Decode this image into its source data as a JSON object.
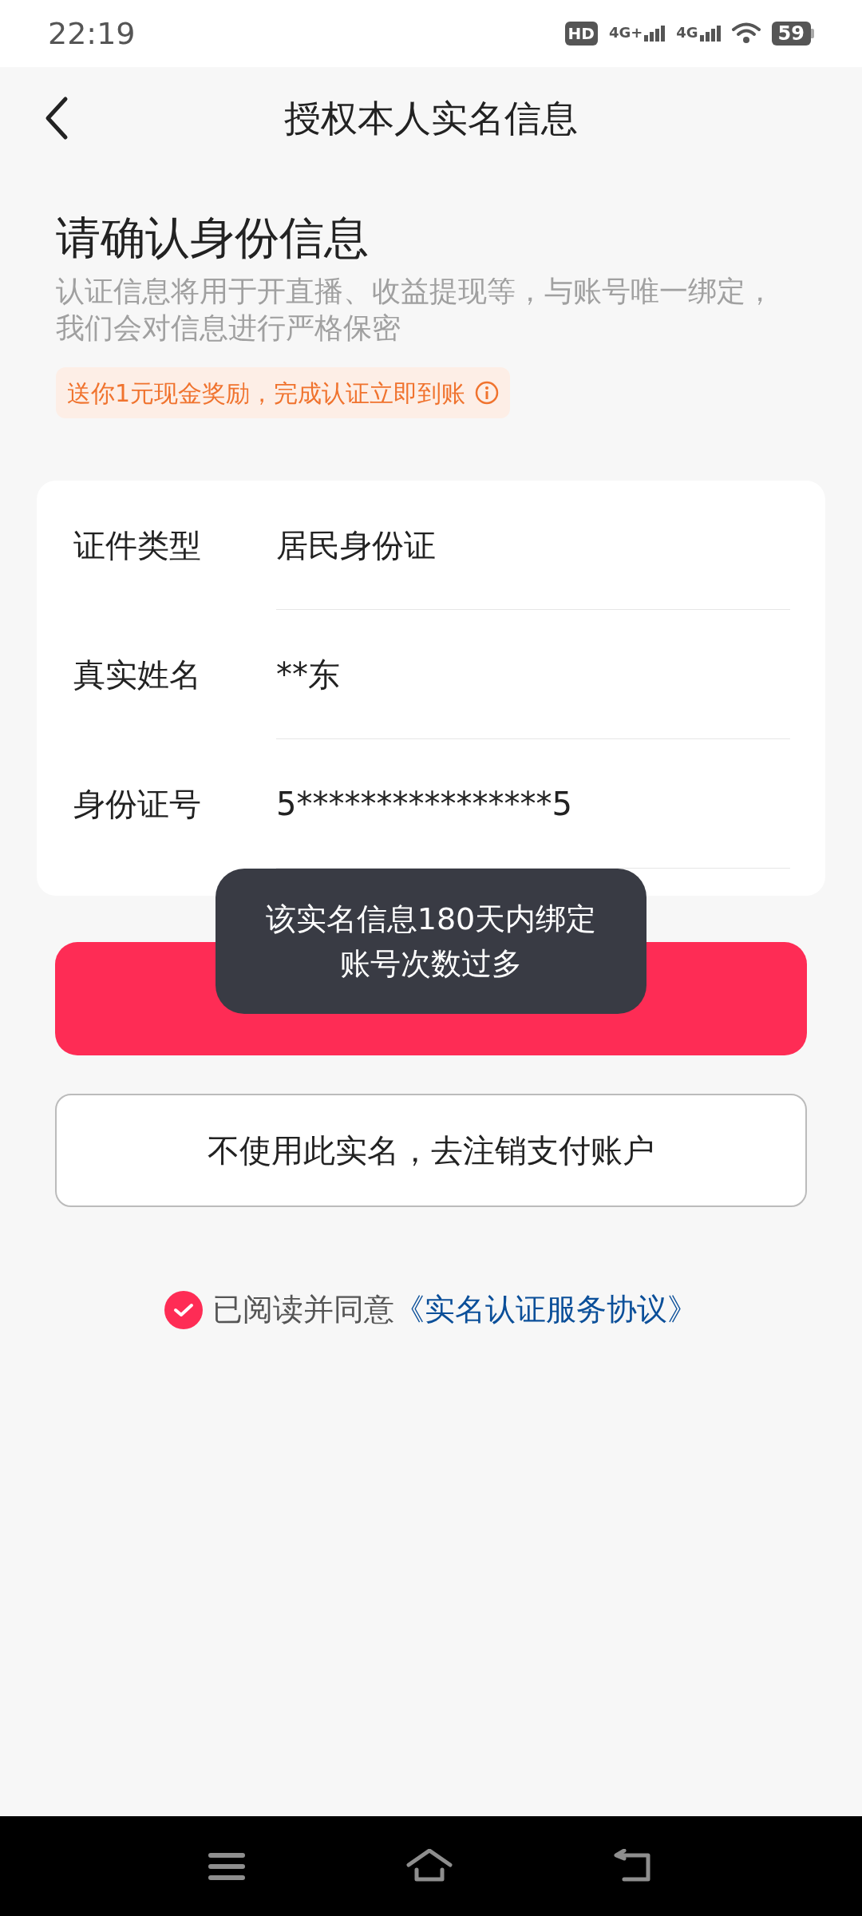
{
  "status_bar": {
    "time": "22:19",
    "hd": "HD",
    "networks": [
      "4G+",
      "4G"
    ],
    "battery": "59"
  },
  "header": {
    "title": "授权本人实名信息"
  },
  "intro": {
    "heading": "请确认身份信息",
    "description": "认证信息将用于开直播、收益提现等，与账号唯一绑定，我们会对信息进行严格保密",
    "reward": "送你1元现金奖励，完成认证立即到账"
  },
  "fields": [
    {
      "label": "证件类型",
      "value": "居民身份证"
    },
    {
      "label": "真实姓名",
      "value": "**东"
    },
    {
      "label": "身份证号",
      "value": "5****************5"
    }
  ],
  "toast": {
    "lines": [
      "该实名信息180天内绑定",
      "账号次数过多"
    ]
  },
  "secondary_button": "不使用此实名，去注销支付账户",
  "agreement": {
    "checked": true,
    "text": "已阅读并同意",
    "link": "《实名认证服务协议》"
  }
}
